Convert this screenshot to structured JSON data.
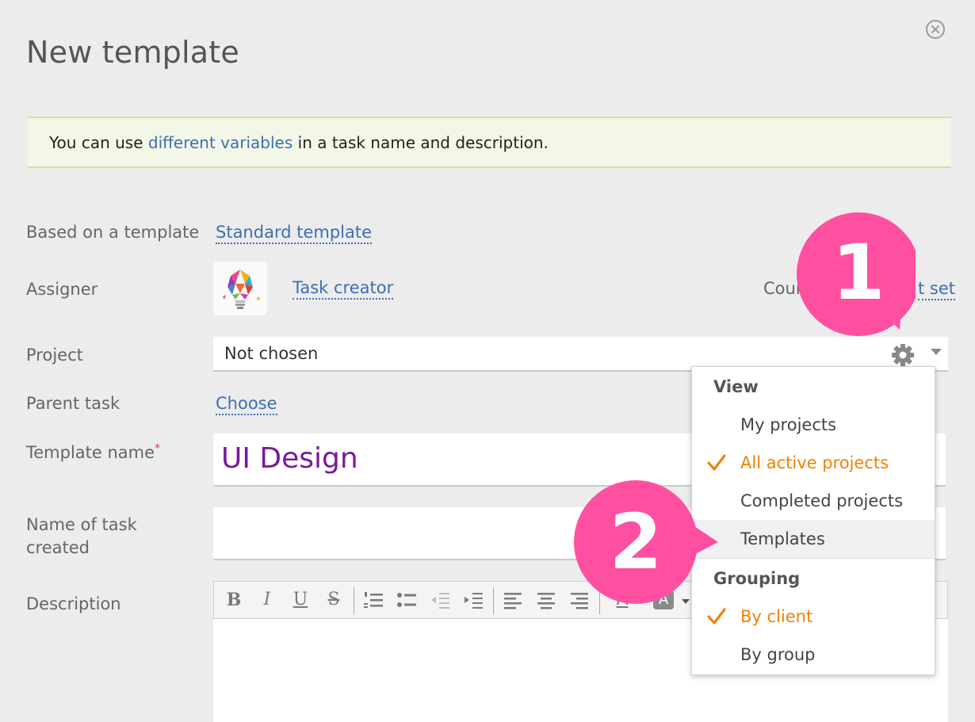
{
  "window": {
    "title": "New template"
  },
  "notice": {
    "prefix": "You can use ",
    "link": "different variables",
    "suffix": " in a task name and description."
  },
  "form": {
    "based_on": {
      "label": "Based on a template",
      "value": "Standard template"
    },
    "assigner": {
      "label": "Assigner",
      "value": "Task creator",
      "counter_label": "Coun",
      "counter_link": "t set"
    },
    "project": {
      "label": "Project",
      "value": "Not chosen"
    },
    "parent_task": {
      "label": "Parent task",
      "value": "Choose"
    },
    "template_name": {
      "label": "Template name",
      "required_mark": "*",
      "value": "UI Design"
    },
    "task_name": {
      "label_line1": "Name of task",
      "label_line2": "created",
      "value": ""
    },
    "description": {
      "label": "Description"
    }
  },
  "toolbar": {
    "bold": "B",
    "italic": "I",
    "underline": "U",
    "strike": "S",
    "font_color": "A",
    "bg_color": "A"
  },
  "dropdown": {
    "view_header": "View",
    "view_items": [
      {
        "label": "My projects",
        "checked": false
      },
      {
        "label": "All active projects",
        "checked": true
      },
      {
        "label": "Completed projects",
        "checked": false
      },
      {
        "label": "Templates",
        "checked": false
      }
    ],
    "grouping_header": "Grouping",
    "grouping_items": [
      {
        "label": "By client",
        "checked": true
      },
      {
        "label": "By group",
        "checked": false
      }
    ]
  },
  "markers": {
    "first": "1",
    "second": "2"
  },
  "colors": {
    "accent": "#f08200",
    "link": "#3d6fb3",
    "marker": "#ff4fa0",
    "template_name": "#7a1a9a"
  }
}
